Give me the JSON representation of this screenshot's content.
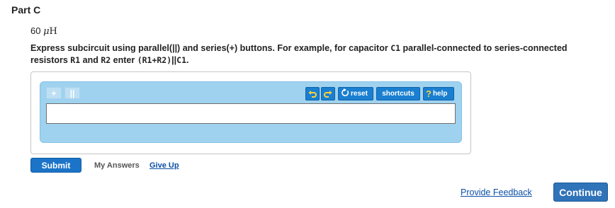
{
  "part": {
    "title": "Part C"
  },
  "given": {
    "number": "60",
    "mu": "μ",
    "unit": "H"
  },
  "instructions": {
    "t1": "Express subcircuit using parallel(||) and series(+) buttons. For example, for capacitor ",
    "c1": "C1",
    "t2": " parallel-connected to series-connected resistors ",
    "r1": "R1",
    "t3": " and ",
    "r2": "R2",
    "t4": " enter ",
    "expr": "(R1+R2)",
    "t5": "||",
    "c1b": "C1",
    "t6": "."
  },
  "toolbar": {
    "series_label": "+",
    "parallel_label": "||",
    "reset_label": "reset",
    "shortcuts_label": "shortcuts",
    "help_q": "?",
    "help_label": "help"
  },
  "answer": {
    "value": ""
  },
  "actions": {
    "submit_label": "Submit",
    "my_answers_label": "My Answers",
    "give_up_label": "Give Up",
    "provide_feedback_label": "Provide Feedback",
    "continue_label": "Continue"
  },
  "colors": {
    "accent_blue": "#1a7fd0",
    "editor_frame": "#9fd2ef",
    "link": "#0b4fa7",
    "continue_bg": "#2f73b8"
  },
  "icons": [
    "undo-icon",
    "redo-icon",
    "reset-icon",
    "help-icon"
  ]
}
